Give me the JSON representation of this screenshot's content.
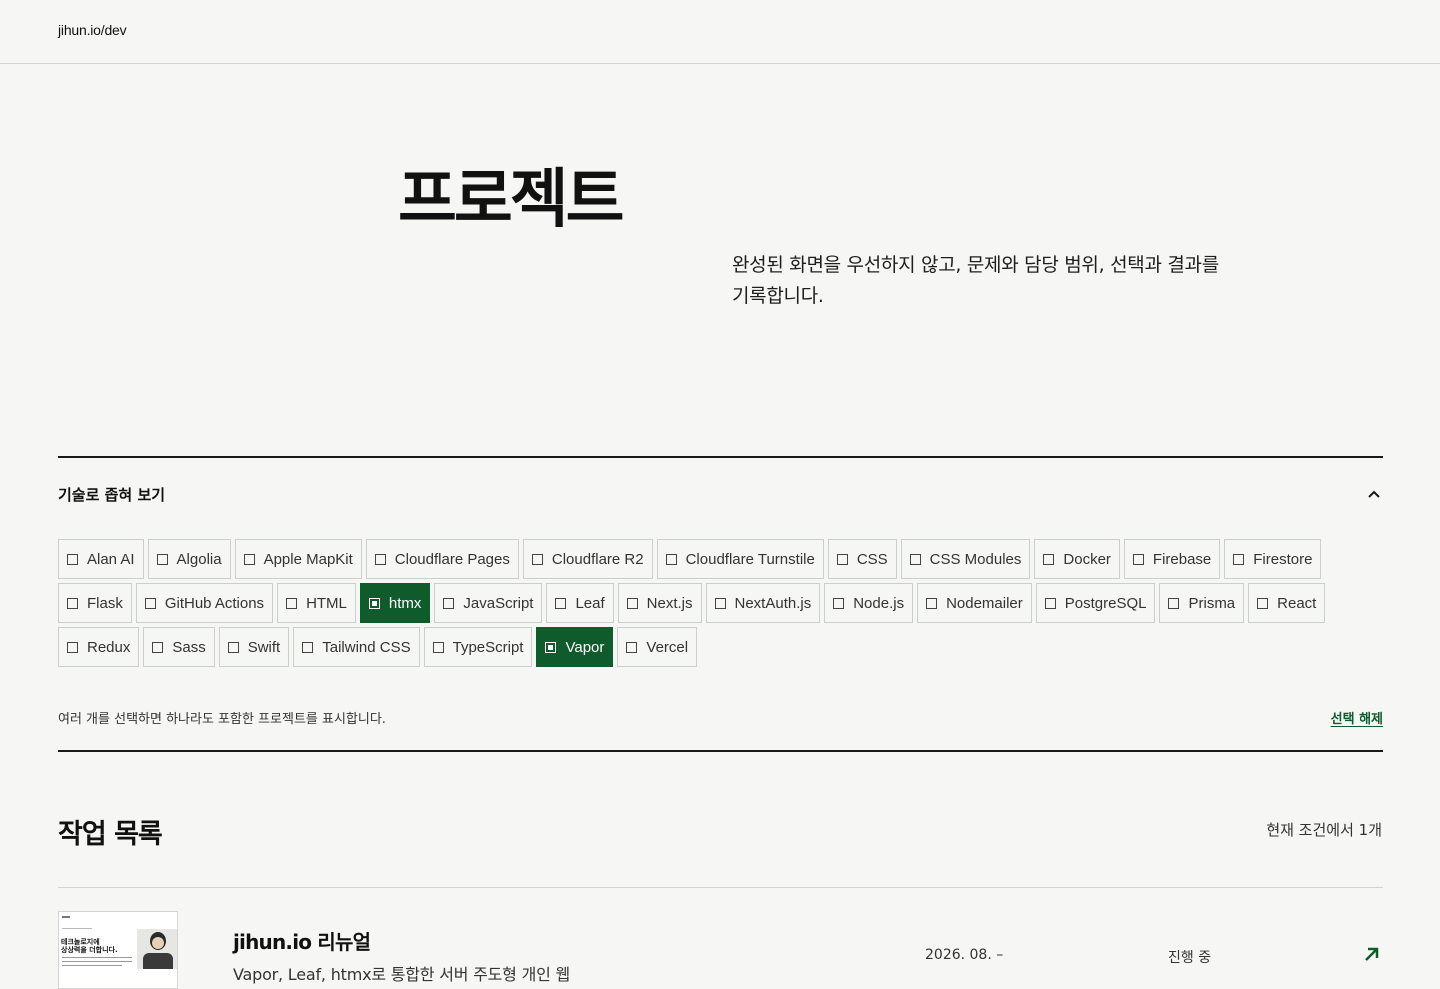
{
  "header": {
    "logo": "jihun.io/dev"
  },
  "hero": {
    "title": "프로젝트",
    "description": "완성된 화면을 우선하지 않고, 문제와 담당 범위, 선택과 결과를 기록합니다."
  },
  "filter": {
    "title": "기술로 좁혀 보기",
    "collapse_icon": "chevron-up-icon",
    "rows": [
      [
        {
          "label": "Alan AI",
          "selected": false
        },
        {
          "label": "Algolia",
          "selected": false
        },
        {
          "label": "Apple MapKit",
          "selected": false
        },
        {
          "label": "Cloudflare Pages",
          "selected": false
        },
        {
          "label": "Cloudflare R2",
          "selected": false
        },
        {
          "label": "Cloudflare Turnstile",
          "selected": false
        },
        {
          "label": "CSS",
          "selected": false
        },
        {
          "label": "CSS Modules",
          "selected": false
        },
        {
          "label": "Docker",
          "selected": false
        },
        {
          "label": "Firebase",
          "selected": false
        },
        {
          "label": "Firestore",
          "selected": false
        }
      ],
      [
        {
          "label": "Flask",
          "selected": false
        },
        {
          "label": "GitHub Actions",
          "selected": false
        },
        {
          "label": "HTML",
          "selected": false
        },
        {
          "label": "htmx",
          "selected": true
        },
        {
          "label": "JavaScript",
          "selected": false
        },
        {
          "label": "Leaf",
          "selected": false
        },
        {
          "label": "Next.js",
          "selected": false
        },
        {
          "label": "NextAuth.js",
          "selected": false
        },
        {
          "label": "Node.js",
          "selected": false
        },
        {
          "label": "Nodemailer",
          "selected": false
        },
        {
          "label": "PostgreSQL",
          "selected": false
        },
        {
          "label": "Prisma",
          "selected": false
        },
        {
          "label": "React",
          "selected": false
        }
      ],
      [
        {
          "label": "Redux",
          "selected": false
        },
        {
          "label": "Sass",
          "selected": false
        },
        {
          "label": "Swift",
          "selected": false
        },
        {
          "label": "Tailwind CSS",
          "selected": false
        },
        {
          "label": "TypeScript",
          "selected": false
        },
        {
          "label": "Vapor",
          "selected": true
        },
        {
          "label": "Vercel",
          "selected": false
        }
      ]
    ],
    "hint": "여러 개를 선택하면 하나라도 포함한 프로젝트를 표시합니다.",
    "clear_label": "선택 해제"
  },
  "list": {
    "title": "작업 목록",
    "count": "현재 조건에서 1개",
    "items": [
      {
        "title": "jihun.io 리뉴얼",
        "description": "Vapor, Leaf, htmx로 통합한 서버 주도형 개인 웹",
        "date": "2026. 08. –",
        "status": "진행 중",
        "thumb_heading": "테크놀로지에\n상상력을 더합니다.",
        "arrow_icon": "arrow-up-right-icon"
      }
    ]
  },
  "colors": {
    "accent": "#0f5b2c",
    "background": "#f6f7f5",
    "rule": "#1a1a1a"
  }
}
